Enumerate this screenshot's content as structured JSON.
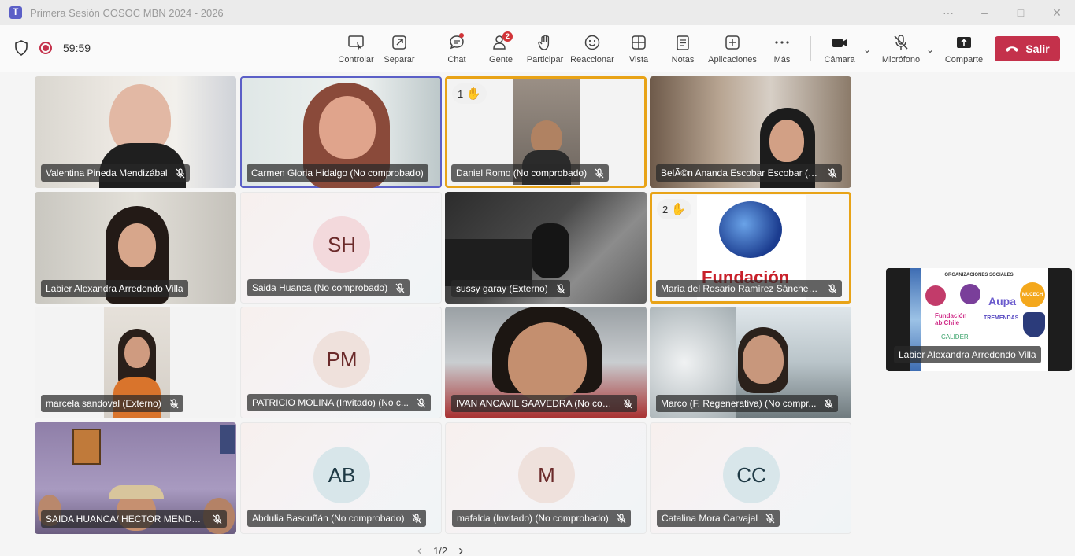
{
  "window": {
    "title": "Primera Sesión COSOC MBN 2024 - 2026",
    "controls": [
      "···",
      "–",
      "□",
      "✕"
    ]
  },
  "meeting": {
    "timer": "59:59"
  },
  "toolbar": {
    "controlar": "Controlar",
    "separar": "Separar",
    "chat": "Chat",
    "gente": "Gente",
    "gente_badge": "2",
    "participar": "Participar",
    "reaccionar": "Reaccionar",
    "vista": "Vista",
    "notas": "Notas",
    "aplicaciones": "Aplicaciones",
    "mas": "Más",
    "camara": "Cámara",
    "microfono": "Micrófono",
    "comparte": "Comparte",
    "salir": "Salir"
  },
  "tiles": [
    {
      "name": "Valentina Pineda Mendizábal",
      "type": "video"
    },
    {
      "name": "Carmen Gloria Hidalgo (No comprobado)",
      "type": "video",
      "speaking": true
    },
    {
      "name": "Daniel Romo (No comprobado)",
      "type": "video",
      "hand": "1"
    },
    {
      "name": "BelÃ©n Ananda Escobar Escobar (E...",
      "type": "video"
    },
    {
      "name": "Labier Alexandra Arredondo Villa",
      "type": "video"
    },
    {
      "name": "Saida Huanca (No comprobado)",
      "type": "avatar",
      "initials": "SH",
      "avatar_color": "#f3d9dc"
    },
    {
      "name": "sussy garay (Externo)",
      "type": "video"
    },
    {
      "name": "María del Rosario Ramírez Sánchez ...",
      "type": "video",
      "hand": "2",
      "video_text": "Fundación"
    },
    {
      "name": "marcela sandoval (Externo)",
      "type": "video"
    },
    {
      "name": "PATRICIO MOLINA (Invitado) (No c...",
      "type": "avatar",
      "initials": "PM",
      "avatar_color": "#efe1dc"
    },
    {
      "name": "IVAN ANCAVIL SAAVEDRA (No com...",
      "type": "video"
    },
    {
      "name": "Marco (F. Regenerativa) (No compr...",
      "type": "video"
    },
    {
      "name": "SAIDA HUANCA/ HECTOR MENDO...",
      "type": "video"
    },
    {
      "name": "Abdulia Bascuñán (No comprobado)",
      "type": "avatar",
      "initials": "AB",
      "avatar_color": "#d8e6ea"
    },
    {
      "name": "mafalda (Invitado) (No comprobado)",
      "type": "avatar",
      "initials": "M",
      "avatar_color": "#efe1dc"
    },
    {
      "name": "Catalina Mora Carvajal",
      "type": "avatar",
      "initials": "CC",
      "avatar_color": "#d8e6ea"
    }
  ],
  "pager": {
    "prev": "‹",
    "label": "1/2",
    "next": "›"
  },
  "side_tile": {
    "name": "Labier Alexandra Arredondo Villa",
    "heading": "ORGANIZACIONES SOCIALES",
    "logos": [
      "Aupa",
      "MUCECH",
      "Fundación abiChile",
      "TREMENDAS",
      "CALIDER"
    ]
  }
}
